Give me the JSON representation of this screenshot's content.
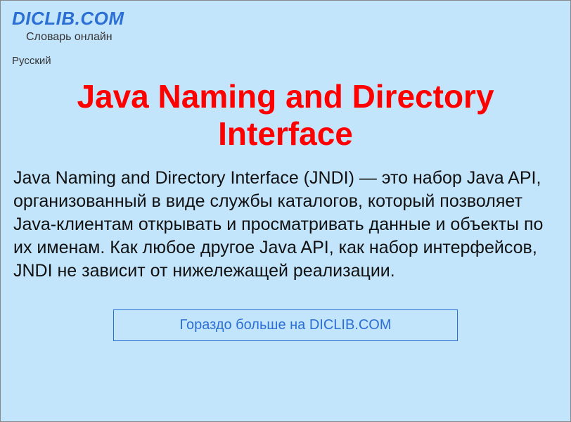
{
  "header": {
    "logo": "DICLIB.COM",
    "tagline": "Словарь онлайн"
  },
  "language": "Русский",
  "title": "Java Naming and Directory Interface",
  "body": "Java Naming and Directory Interface (JNDI) — это набор Java API, организованный в виде службы каталогов, который позволяет Java-клиентам открывать и просматривать данные и объекты по их именам. Как любое другое Java API, как набор интерфейсов, JNDI не зависит от нижележащей реализации.",
  "promo": "Гораздо больше на DICLIB.COM"
}
